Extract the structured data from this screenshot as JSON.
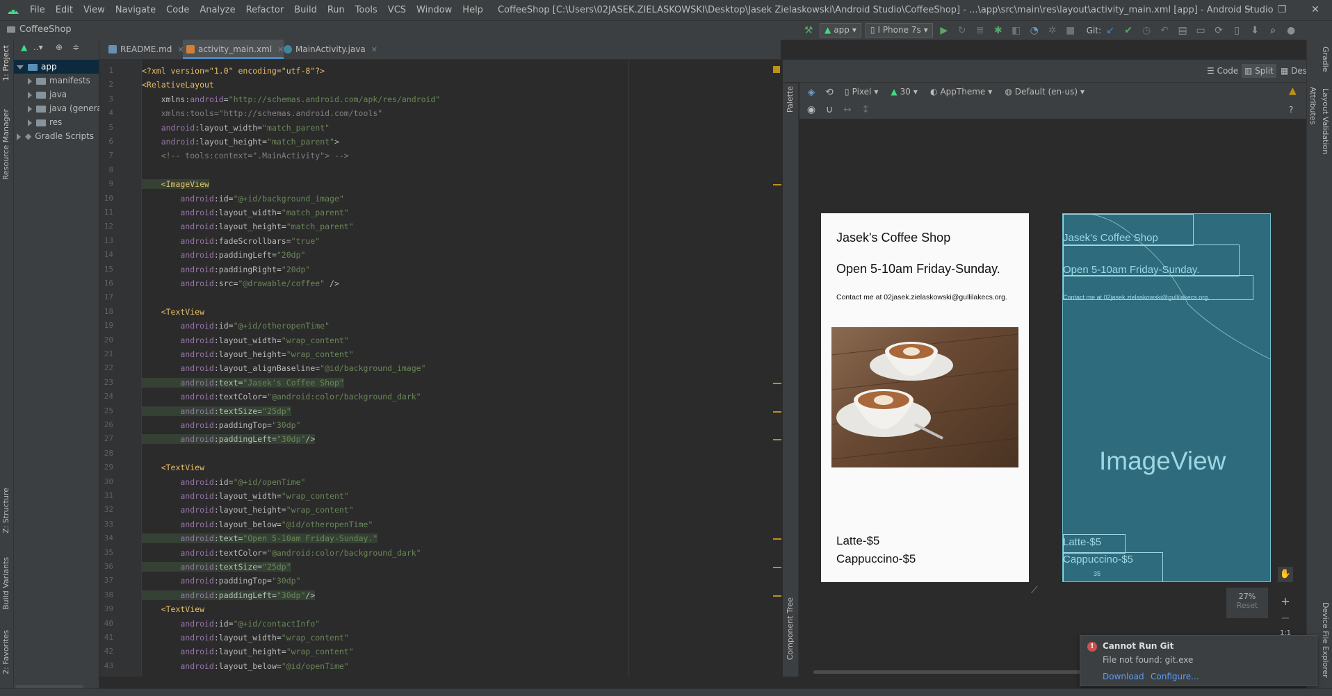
{
  "menubar": {
    "items": [
      "File",
      "Edit",
      "View",
      "Navigate",
      "Code",
      "Analyze",
      "Refactor",
      "Build",
      "Run",
      "Tools",
      "VCS",
      "Window",
      "Help"
    ],
    "window_title": "CoffeeShop [C:\\Users\\02JASEK.ZIELASKOWSKI\\Desktop\\Jasek Zielaskowski\\Android Studio\\CoffeeShop] - ...\\app\\src\\main\\res\\layout\\activity_main.xml [app] - Android Studio"
  },
  "navbar": {
    "project_name": "CoffeeShop",
    "run_config": "app",
    "device": "I Phone 7s",
    "git_label": "Git:"
  },
  "leftstrip": {
    "project_tab": "1: Project",
    "resource_manager": "Resource Manager",
    "structure": "Z: Structure",
    "build_variants": "Build Variants",
    "favorites": "2: Favorites"
  },
  "project_panel": {
    "title_dropdown": "..▾",
    "tree": [
      {
        "label": "app",
        "level": 0,
        "expanded": true,
        "selected": true
      },
      {
        "label": "manifests",
        "level": 1,
        "expanded": false
      },
      {
        "label": "java",
        "level": 1,
        "expanded": false
      },
      {
        "label": "java (genera",
        "level": 1,
        "expanded": false
      },
      {
        "label": "res",
        "level": 1,
        "expanded": false
      },
      {
        "label": "Gradle Scripts",
        "level": 0,
        "expanded": false
      }
    ]
  },
  "tabs": [
    {
      "label": "README.md",
      "active": false,
      "icon_color": "#6a8fb0"
    },
    {
      "label": "activity_main.xml",
      "active": true,
      "icon_color": "#d0803a"
    },
    {
      "label": "MainActivity.java",
      "active": false,
      "icon_color": "#3e86a0"
    }
  ],
  "editor": {
    "lines": [
      {
        "n": "1",
        "segs": [
          [
            "pi",
            "<?xml version=\"1.0\" encoding=\"utf-8\"?>"
          ]
        ]
      },
      {
        "n": "2",
        "segs": [
          [
            "tag",
            "<RelativeLayout"
          ]
        ]
      },
      {
        "n": "3",
        "segs": [
          [
            "attr",
            "    xmlns:"
          ],
          [
            "ns",
            "android"
          ],
          [
            "attr",
            "="
          ],
          [
            "val",
            "\"http://schemas.android.com/apk/res/android\""
          ]
        ]
      },
      {
        "n": "4",
        "segs": [
          [
            "cmt",
            "    xmlns:tools=\"http://schemas.android.com/tools\""
          ]
        ]
      },
      {
        "n": "5",
        "segs": [
          [
            "ns",
            "    android"
          ],
          [
            "attr",
            ":layout_width="
          ],
          [
            "val",
            "\"match_parent\""
          ]
        ]
      },
      {
        "n": "6",
        "segs": [
          [
            "ns",
            "    android"
          ],
          [
            "attr",
            ":layout_height="
          ],
          [
            "val",
            "\"match_parent\""
          ],
          [
            "attr",
            ">"
          ]
        ]
      },
      {
        "n": "7",
        "segs": [
          [
            "cmt",
            "    <!-- tools:context=\".MainActivity\"> -->"
          ]
        ]
      },
      {
        "n": "8",
        "segs": []
      },
      {
        "n": "9",
        "segs": [
          [
            "tag",
            "    <ImageView"
          ]
        ],
        "hl": true
      },
      {
        "n": "10",
        "segs": [
          [
            "ns",
            "        android"
          ],
          [
            "attr",
            ":id="
          ],
          [
            "val",
            "\"@+id/background_image\""
          ]
        ]
      },
      {
        "n": "11",
        "segs": [
          [
            "ns",
            "        android"
          ],
          [
            "attr",
            ":layout_width="
          ],
          [
            "val",
            "\"match_parent\""
          ]
        ]
      },
      {
        "n": "12",
        "segs": [
          [
            "ns",
            "        android"
          ],
          [
            "attr",
            ":layout_height="
          ],
          [
            "val",
            "\"match_parent\""
          ]
        ]
      },
      {
        "n": "13",
        "segs": [
          [
            "ns",
            "        android"
          ],
          [
            "attr",
            ":fadeScrollbars="
          ],
          [
            "val",
            "\"true\""
          ]
        ]
      },
      {
        "n": "14",
        "segs": [
          [
            "ns",
            "        android"
          ],
          [
            "attr",
            ":paddingLeft="
          ],
          [
            "val",
            "\"20dp\""
          ]
        ]
      },
      {
        "n": "15",
        "segs": [
          [
            "ns",
            "        android"
          ],
          [
            "attr",
            ":paddingRight="
          ],
          [
            "val",
            "\"20dp\""
          ]
        ]
      },
      {
        "n": "16",
        "segs": [
          [
            "ns",
            "        android"
          ],
          [
            "attr",
            ":src="
          ],
          [
            "val",
            "\"@drawable/coffee\""
          ],
          [
            "attr",
            " />"
          ]
        ]
      },
      {
        "n": "17",
        "segs": []
      },
      {
        "n": "18",
        "segs": [
          [
            "tag",
            "    <TextView"
          ]
        ]
      },
      {
        "n": "19",
        "segs": [
          [
            "ns",
            "        android"
          ],
          [
            "attr",
            ":id="
          ],
          [
            "val",
            "\"@+id/otheropenTime\""
          ]
        ]
      },
      {
        "n": "20",
        "segs": [
          [
            "ns",
            "        android"
          ],
          [
            "attr",
            ":layout_width="
          ],
          [
            "val",
            "\"wrap_content\""
          ]
        ]
      },
      {
        "n": "21",
        "segs": [
          [
            "ns",
            "        android"
          ],
          [
            "attr",
            ":layout_height="
          ],
          [
            "val",
            "\"wrap_content\""
          ]
        ]
      },
      {
        "n": "22",
        "segs": [
          [
            "ns",
            "        android"
          ],
          [
            "attr",
            ":layout_alignBaseline="
          ],
          [
            "val",
            "\"@id/background_image\""
          ]
        ]
      },
      {
        "n": "23",
        "segs": [
          [
            "ns",
            "        android"
          ],
          [
            "attr",
            ":text="
          ],
          [
            "val",
            "\"Jasek's Coffee Shop\""
          ]
        ],
        "hl": true
      },
      {
        "n": "24",
        "segs": [
          [
            "ns",
            "        android"
          ],
          [
            "attr",
            ":textColor="
          ],
          [
            "val",
            "\"@android:color/background_dark\""
          ]
        ]
      },
      {
        "n": "25",
        "segs": [
          [
            "ns",
            "        android"
          ],
          [
            "attr",
            ":textSize="
          ],
          [
            "val",
            "\"25dp\""
          ]
        ],
        "hl": true
      },
      {
        "n": "26",
        "segs": [
          [
            "ns",
            "        android"
          ],
          [
            "attr",
            ":paddingTop="
          ],
          [
            "val",
            "\"30dp\""
          ]
        ]
      },
      {
        "n": "27",
        "segs": [
          [
            "ns",
            "        android"
          ],
          [
            "attr",
            ":paddingLeft="
          ],
          [
            "val",
            "\"30dp\""
          ],
          [
            "attr",
            "/>"
          ]
        ],
        "hl": true
      },
      {
        "n": "28",
        "segs": []
      },
      {
        "n": "29",
        "segs": [
          [
            "tag",
            "    <TextView"
          ]
        ]
      },
      {
        "n": "30",
        "segs": [
          [
            "ns",
            "        android"
          ],
          [
            "attr",
            ":id="
          ],
          [
            "val",
            "\"@+id/openTime\""
          ]
        ]
      },
      {
        "n": "31",
        "segs": [
          [
            "ns",
            "        android"
          ],
          [
            "attr",
            ":layout_width="
          ],
          [
            "val",
            "\"wrap_content\""
          ]
        ]
      },
      {
        "n": "32",
        "segs": [
          [
            "ns",
            "        android"
          ],
          [
            "attr",
            ":layout_height="
          ],
          [
            "val",
            "\"wrap_content\""
          ]
        ]
      },
      {
        "n": "33",
        "segs": [
          [
            "ns",
            "        android"
          ],
          [
            "attr",
            ":layout_below="
          ],
          [
            "val",
            "\"@id/otheropenTime\""
          ]
        ]
      },
      {
        "n": "34",
        "segs": [
          [
            "ns",
            "        android"
          ],
          [
            "attr",
            ":text="
          ],
          [
            "val",
            "\"Open 5-10am Friday-Sunday.\""
          ]
        ],
        "hl": true
      },
      {
        "n": "35",
        "segs": [
          [
            "ns",
            "        android"
          ],
          [
            "attr",
            ":textColor="
          ],
          [
            "val",
            "\"@android:color/background_dark\""
          ]
        ]
      },
      {
        "n": "36",
        "segs": [
          [
            "ns",
            "        android"
          ],
          [
            "attr",
            ":textSize="
          ],
          [
            "val",
            "\"25dp\""
          ]
        ],
        "hl": true
      },
      {
        "n": "37",
        "segs": [
          [
            "ns",
            "        android"
          ],
          [
            "attr",
            ":paddingTop="
          ],
          [
            "val",
            "\"30dp\""
          ]
        ]
      },
      {
        "n": "38",
        "segs": [
          [
            "ns",
            "        android"
          ],
          [
            "attr",
            ":paddingLeft="
          ],
          [
            "val",
            "\"30dp\""
          ],
          [
            "attr",
            "/>"
          ]
        ],
        "hl": true
      },
      {
        "n": "39",
        "segs": [
          [
            "tag",
            "    <TextView"
          ]
        ]
      },
      {
        "n": "40",
        "segs": [
          [
            "ns",
            "        android"
          ],
          [
            "attr",
            ":id="
          ],
          [
            "val",
            "\"@+id/contactInfo\""
          ]
        ]
      },
      {
        "n": "41",
        "segs": [
          [
            "ns",
            "        android"
          ],
          [
            "attr",
            ":layout_width="
          ],
          [
            "val",
            "\"wrap_content\""
          ]
        ]
      },
      {
        "n": "42",
        "segs": [
          [
            "ns",
            "        android"
          ],
          [
            "attr",
            ":layout_height="
          ],
          [
            "val",
            "\"wrap_content\""
          ]
        ]
      },
      {
        "n": "43",
        "segs": [
          [
            "ns",
            "        android"
          ],
          [
            "attr",
            ":layout_below="
          ],
          [
            "val",
            "\"@id/openTime\""
          ]
        ]
      }
    ]
  },
  "design": {
    "view_modes": {
      "code": "Code",
      "split": "Split",
      "design": "Design"
    },
    "toolbar": {
      "device": "Pixel",
      "api": "30",
      "theme": "AppTheme",
      "locale": "Default (en-us)"
    },
    "palette_label": "Palette",
    "component_tree_label": "Component Tree",
    "attributes_label": "Attributes",
    "layout_validation_label": "Layout Validation",
    "gradle_label": "Gradle",
    "device_explorer_label": "Device File Explorer",
    "preview": {
      "title": "Jasek's Coffee Shop",
      "hours": "Open 5-10am Friday-Sunday.",
      "contact": "Contact me at 02jasek.zielaskowski@gullilakecs.org.",
      "menu1": "Latte-$5",
      "menu2": "Cappuccino-$5"
    },
    "blueprint": {
      "title": "Jasek's Coffee Shop",
      "hours": "Open 5-10am Friday-Sunday.",
      "contact": "Contact me at 02jasek.zielaskowski@gullilakecs.org.",
      "image_label": "ImageView",
      "menu1": "Latte-$5",
      "menu2": "Cappuccino-$5",
      "small": "35"
    },
    "zoom": {
      "level": "27%",
      "reset": "Reset",
      "ratio": "1:1"
    }
  },
  "notification": {
    "title": "Cannot Run Git",
    "message": "File not found: git.exe",
    "action_download": "Download",
    "action_configure": "Configure..."
  },
  "colors": {
    "accent": "#4a88c7",
    "warning": "#be9117",
    "error": "#c75450",
    "blueprint": "#2e6b7c"
  }
}
